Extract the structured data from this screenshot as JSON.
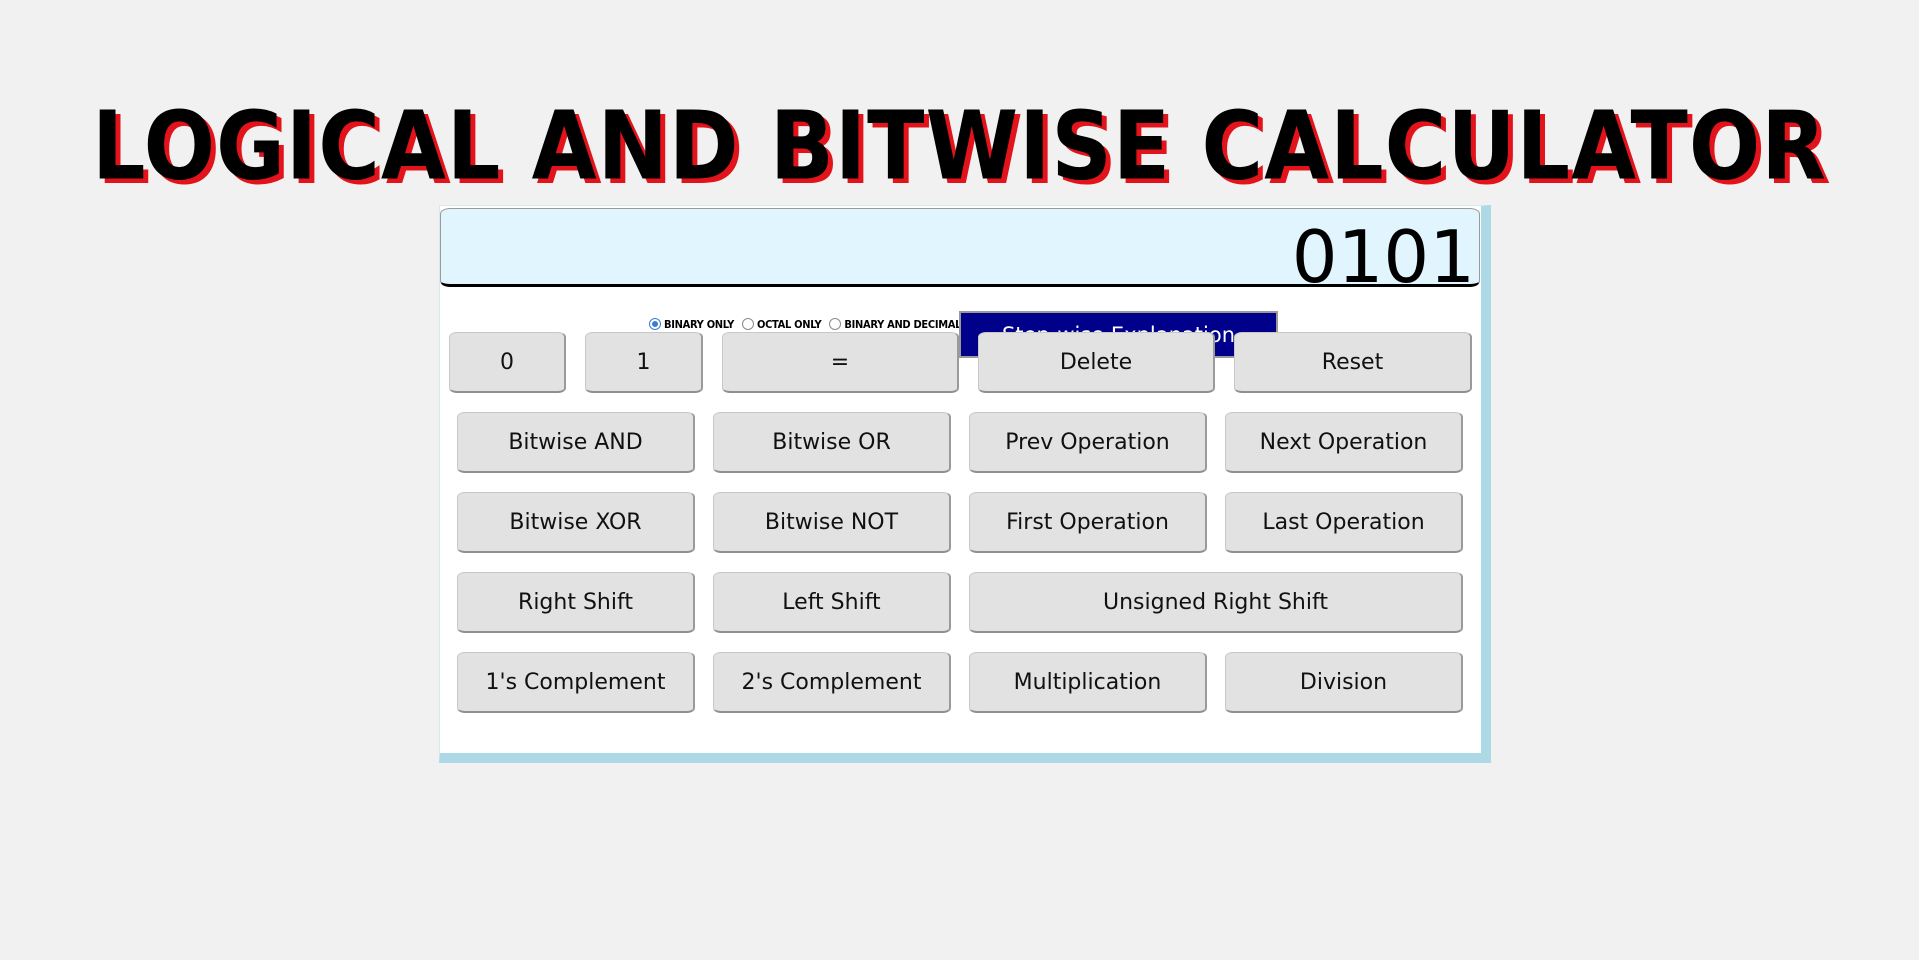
{
  "title": "LOGICAL AND BITWISE CALCULATOR",
  "display": {
    "value": "0101"
  },
  "modes": [
    {
      "label": "Binary Only",
      "selected": true
    },
    {
      "label": "Octal Only",
      "selected": false
    },
    {
      "label": "Binary and Decimal",
      "selected": false
    }
  ],
  "explain_button": "Step-wise Explanation",
  "rows": [
    [
      "0",
      "1",
      "=",
      "Delete",
      "Reset"
    ],
    [
      "Bitwise AND",
      "Bitwise OR",
      "Prev Operation",
      "Next Operation"
    ],
    [
      "Bitwise XOR",
      "Bitwise NOT",
      "First Operation",
      "Last Operation"
    ],
    [
      "Right Shift",
      "Left Shift",
      "Unsigned Right Shift"
    ],
    [
      "1's Complement",
      "2's Complement",
      "Multiplication",
      "Division"
    ]
  ],
  "colors": {
    "title": "#000000",
    "title_shadow": "#e3131b",
    "display_bg": "#e0f5fd",
    "explain_bg": "#00008b",
    "button_bg": "#e2e2e2",
    "panel_border": "#add8e6"
  }
}
